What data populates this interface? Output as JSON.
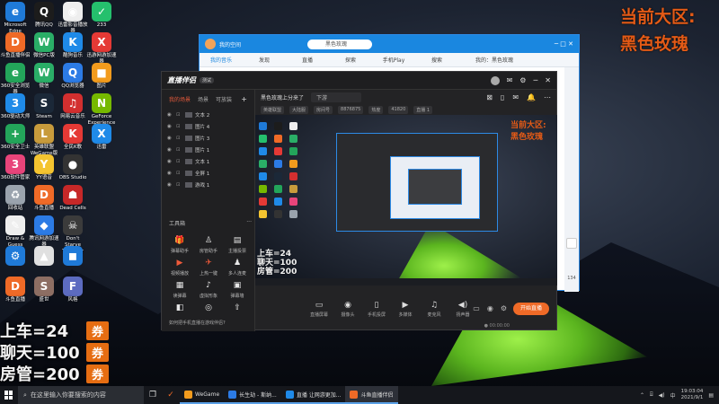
{
  "desktop": {
    "icons": [
      {
        "label": "Microsoft Edge",
        "glyph": "e",
        "color": "#1f7ad8"
      },
      {
        "label": "腾讯QQ",
        "glyph": "Q",
        "color": "#1c1c1c"
      },
      {
        "label": "迅雷影音播放器",
        "glyph": "◉",
        "color": "#eeeeee"
      },
      {
        "label": "233",
        "glyph": "✓",
        "color": "#25c06d"
      },
      {
        "label": "斗鱼直播伴侣",
        "glyph": "D",
        "color": "#ef6a27"
      },
      {
        "label": "微信PC版",
        "glyph": "W",
        "color": "#2aae67"
      },
      {
        "label": "酷狗音乐",
        "glyph": "K",
        "color": "#1f8ae8"
      },
      {
        "label": "迅游网游加速器",
        "glyph": "X",
        "color": "#e53935"
      },
      {
        "label": "360安全浏览器",
        "glyph": "e",
        "color": "#23a55a"
      },
      {
        "label": "微信",
        "glyph": "W",
        "color": "#2aae67"
      },
      {
        "label": "QQ浏览器",
        "glyph": "Q",
        "color": "#2c7be5"
      },
      {
        "label": "图片",
        "glyph": "■",
        "color": "#f29b1d"
      },
      {
        "label": "360驱动大师",
        "glyph": "3",
        "color": "#1f8ae8"
      },
      {
        "label": "Steam",
        "glyph": "S",
        "color": "#1b2838"
      },
      {
        "label": "网易云音乐",
        "glyph": "♫",
        "color": "#d32f2f"
      },
      {
        "label": "GeForce Experience",
        "glyph": "N",
        "color": "#76b900"
      },
      {
        "label": "360安全卫士",
        "glyph": "+",
        "color": "#23a55a"
      },
      {
        "label": "英雄联盟WeGame版",
        "glyph": "L",
        "color": "#c89b3c"
      },
      {
        "label": "全民K歌",
        "glyph": "K",
        "color": "#e53935"
      },
      {
        "label": "迅雷",
        "glyph": "X",
        "color": "#1f8ae8"
      },
      {
        "label": "360软件管家",
        "glyph": "3",
        "color": "#e8447a"
      },
      {
        "label": "YY语音",
        "glyph": "Y",
        "color": "#f4c430"
      },
      {
        "label": "OBS Studio",
        "glyph": "●",
        "color": "#333333"
      },
      {
        "label": "",
        "glyph": "",
        "color": "transparent"
      },
      {
        "label": "回收站",
        "glyph": "♻",
        "color": "#9aa3ad"
      },
      {
        "label": "斗鱼直播",
        "glyph": "D",
        "color": "#ef6a27"
      },
      {
        "label": "Dead Cells",
        "glyph": "☗",
        "color": "#c62828"
      },
      {
        "label": "",
        "glyph": "",
        "color": "transparent"
      },
      {
        "label": "Draw & Guess",
        "glyph": "✎",
        "color": "#eeeeee"
      },
      {
        "label": "腾讯网游加速器",
        "glyph": "◆",
        "color": "#2c7be5"
      },
      {
        "label": "Don't Starve Together",
        "glyph": "☠",
        "color": "#3b3b3b"
      },
      {
        "label": "",
        "glyph": "",
        "color": "transparent"
      },
      {
        "label": "",
        "glyph": "⚙",
        "color": "#1f7ad8"
      },
      {
        "label": "",
        "glyph": "▲",
        "color": "#e0e0e0"
      },
      {
        "label": "",
        "glyph": "◼",
        "color": "#1f7ad8"
      },
      {
        "label": "",
        "glyph": "",
        "color": "transparent"
      },
      {
        "label": "斗鱼直播",
        "glyph": "D",
        "color": "#ef6a27"
      },
      {
        "label": "盛世",
        "glyph": "S",
        "color": "#8d6e63"
      },
      {
        "label": "风格",
        "glyph": "F",
        "color": "#5c6bc0"
      },
      {
        "label": "",
        "glyph": "",
        "color": "transparent"
      }
    ]
  },
  "overlay": {
    "top_line1": "当前大区:",
    "top_line2": "黑色玫瑰",
    "rows": [
      {
        "text": "上车=24",
        "tag": "券"
      },
      {
        "text": "聊天=100",
        "tag": "券"
      },
      {
        "text": "房管=200",
        "tag": "券"
      }
    ]
  },
  "bg_window": {
    "user": "我的空间",
    "search_placeholder": "黑色玫瑰",
    "tabs": [
      "我的音乐",
      "发现",
      "直播",
      "探索",
      "手机Play",
      "搜索",
      "我的：黑色玫瑰"
    ],
    "side_number": "134"
  },
  "app": {
    "logo": "直播伴侣",
    "badge": "测试",
    "left_tabs": [
      "我的场景",
      "场景",
      "可放装"
    ],
    "sources": [
      "文本 2",
      "图片 4",
      "图片 3",
      "图片 1",
      "文本 1",
      "全屏 1",
      "游戏 1"
    ],
    "tools_title": "工具箱",
    "tools_more": "···",
    "tools": [
      {
        "icon": "gift-icon",
        "glyph": "🎁",
        "label": "弹幕助手",
        "accent": true
      },
      {
        "icon": "user-icon",
        "glyph": "♙",
        "label": "房管助手",
        "accent": false
      },
      {
        "icon": "chat-icon",
        "glyph": "▤",
        "label": "主播投票",
        "accent": false
      },
      {
        "icon": "video-icon",
        "glyph": "▶",
        "label": "视频播放",
        "accent": true
      },
      {
        "icon": "rocket-icon",
        "glyph": "✈",
        "label": "上热一键",
        "accent": true
      },
      {
        "icon": "people-icon",
        "glyph": "♟",
        "label": "多人连麦",
        "accent": false
      },
      {
        "icon": "danmaku-icon",
        "glyph": "▦",
        "label": "读弹幕",
        "accent": false
      },
      {
        "icon": "voice-icon",
        "glyph": "♪",
        "label": "虚拟形象",
        "accent": false
      },
      {
        "icon": "record-icon",
        "glyph": "▣",
        "label": "弹幕墙",
        "accent": false
      },
      {
        "icon": "camera-icon",
        "glyph": "◧",
        "label": "",
        "accent": false
      },
      {
        "icon": "mic-icon",
        "glyph": "◎",
        "label": "",
        "accent": false
      },
      {
        "icon": "share-icon",
        "glyph": "⇧",
        "label": "",
        "accent": false
      }
    ],
    "hint": "如何把手机直播在游戏伴侣?",
    "room_title": "黑色玫瑰上分来了",
    "category_select": "下游",
    "chips": [
      "英雄联盟",
      "大陆服",
      "房间号",
      "8876875",
      "热度",
      "41820",
      "直播 1"
    ],
    "bottom_tools": [
      {
        "icon": "screen-icon",
        "glyph": "▭",
        "label": "直播屏幕"
      },
      {
        "icon": "camera-icon",
        "glyph": "◉",
        "label": "摄像头"
      },
      {
        "icon": "phone-icon",
        "glyph": "▯",
        "label": "手机投屏"
      },
      {
        "icon": "media-icon",
        "glyph": "▶",
        "label": "多媒体"
      },
      {
        "icon": "mic-icon",
        "glyph": "♫",
        "label": "麦克风"
      },
      {
        "icon": "speaker-icon",
        "glyph": "◀)",
        "label": "扬声器"
      }
    ],
    "start_button": "开始直播",
    "stats": "● 00:00:00"
  },
  "taskbar": {
    "search_placeholder": "在这里输入你要搜索的内容",
    "apps": [
      {
        "label": "WeGame",
        "color": "#f29b1d",
        "active": false
      },
      {
        "label": "长生劫 - 斯纳...",
        "color": "#2c7be5",
        "active": false
      },
      {
        "label": "直播 让网游更加...",
        "color": "#1f8ae8",
        "active": false
      },
      {
        "label": "斗鱼直播伴侣",
        "color": "#ef6a27",
        "active": true
      }
    ],
    "time": "19:03:04",
    "date": "2021/9/1"
  }
}
